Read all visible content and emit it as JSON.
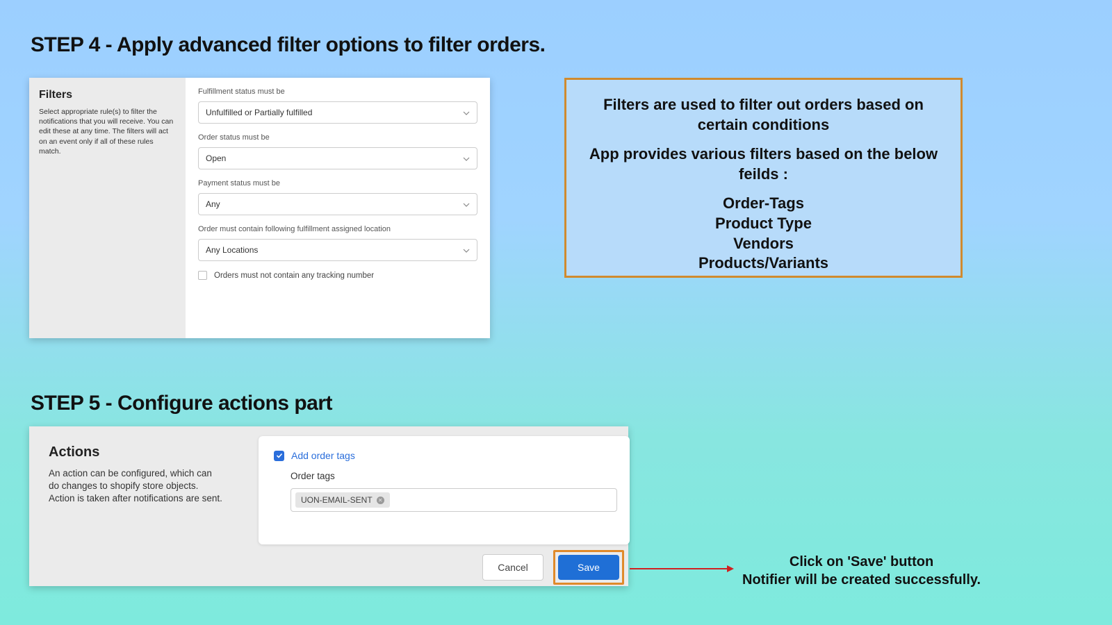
{
  "step4": {
    "title": "STEP 4 - Apply advanced filter options to filter orders.",
    "sidebar_title": "Filters",
    "sidebar_desc": "Select appropriate rule(s) to filter the notifications that you will receive. You can edit these at any time. The filters will act on an event only if all of these rules match.",
    "fields": {
      "fulfillment_label": "Fulfillment status must be",
      "fulfillment_value": "Unfulfilled or Partially fulfilled",
      "order_status_label": "Order status must be",
      "order_status_value": "Open",
      "payment_label": "Payment status must be",
      "payment_value": "Any",
      "location_label": "Order must contain following fulfillment assigned location",
      "location_value": "Any Locations",
      "tracking_checkbox": "Orders must not contain any tracking number"
    }
  },
  "info": {
    "line1": "Filters are used to filter out orders based on certain conditions",
    "line2": "App provides various filters based on the below feilds :",
    "item1": "Order-Tags",
    "item2": "Product Type",
    "item3": "Vendors",
    "item4": "Products/Variants"
  },
  "step5": {
    "title": "STEP 5 - Configure actions part",
    "sidebar_title": "Actions",
    "sidebar_desc": "An action can be configured, which can do changes to shopify store objects. Action is taken after notifications are sent.",
    "add_tags_label": "Add order tags",
    "order_tags_label": "Order tags",
    "tag_value": "UON-EMAIL-SENT",
    "cancel": "Cancel",
    "save": "Save"
  },
  "save_note": {
    "line1": "Click on 'Save' button",
    "line2": "Notifier will be created successfully."
  }
}
